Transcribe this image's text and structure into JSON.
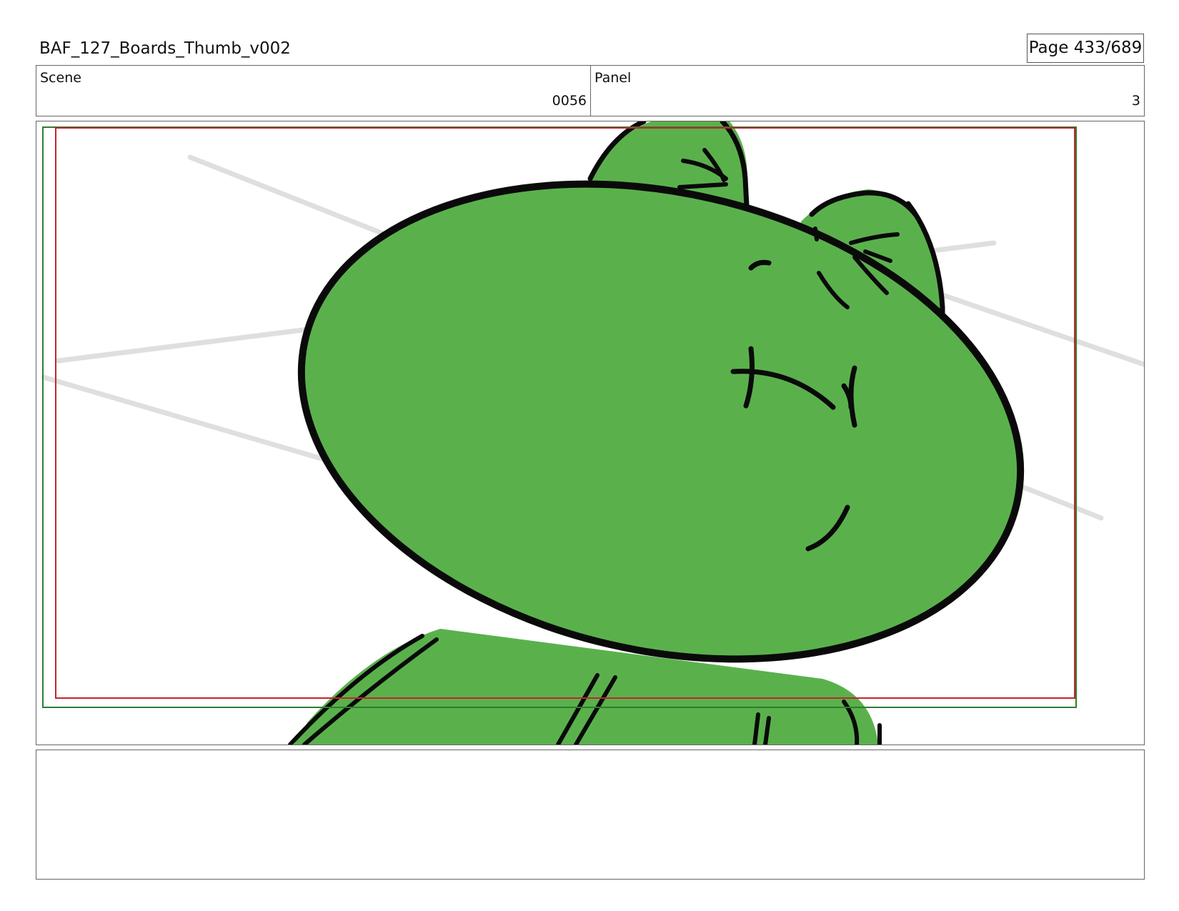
{
  "header": {
    "title": "BAF_127_Boards_Thumb_v002",
    "page_indicator": "Page 433/689"
  },
  "info": {
    "scene_label": "Scene",
    "scene_value": "0056",
    "panel_label": "Panel",
    "panel_value": "3"
  },
  "artwork": {
    "fill_color": "#5ab14c",
    "line_color": "#0a0a0a",
    "safe_frame_color": "#c0272d",
    "action_frame_color": "#2e7d32",
    "background_line_color": "#dcdcdc"
  },
  "notes": {
    "text": ""
  }
}
